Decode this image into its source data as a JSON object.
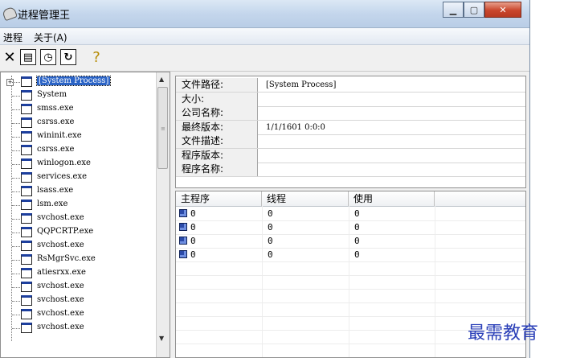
{
  "window": {
    "title": "进程管理王"
  },
  "menu": [
    "进程",
    "关于(A)"
  ],
  "toolbar": {
    "buttons": [
      {
        "name": "kill-process-button",
        "glyph": "✕",
        "icon": "close-icon"
      },
      {
        "name": "properties-button",
        "glyph": "▤",
        "icon": "properties-icon"
      },
      {
        "name": "timer-button",
        "glyph": "◷",
        "icon": "clock-icon"
      },
      {
        "name": "refresh-button",
        "glyph": "↻",
        "icon": "refresh-icon"
      },
      {
        "name": "help-button",
        "glyph": "?",
        "icon": "help-icon"
      }
    ]
  },
  "processes": [
    {
      "label": "[System Process]",
      "selected": true
    },
    {
      "label": "System"
    },
    {
      "label": "smss.exe"
    },
    {
      "label": "csrss.exe"
    },
    {
      "label": "wininit.exe"
    },
    {
      "label": "csrss.exe"
    },
    {
      "label": "winlogon.exe"
    },
    {
      "label": "services.exe"
    },
    {
      "label": "lsass.exe"
    },
    {
      "label": "lsm.exe"
    },
    {
      "label": "svchost.exe"
    },
    {
      "label": "QQPCRTP.exe"
    },
    {
      "label": "svchost.exe"
    },
    {
      "label": "RsMgrSvc.exe"
    },
    {
      "label": "atiesrxx.exe"
    },
    {
      "label": "svchost.exe"
    },
    {
      "label": "svchost.exe"
    },
    {
      "label": "svchost.exe"
    },
    {
      "label": "svchost.exe"
    }
  ],
  "info": [
    {
      "key": "文件路径:",
      "value": "[System Process]"
    },
    {
      "key": "大小:",
      "value": ""
    },
    {
      "key": "公司名称:",
      "value": ""
    },
    {
      "key": "最终版本:",
      "value": "1/1/1601 0:0:0"
    },
    {
      "key": "文件描述:",
      "value": ""
    },
    {
      "key": "程序版本:",
      "value": ""
    },
    {
      "key": "程序名称:",
      "value": ""
    }
  ],
  "modules": {
    "columns": [
      "主程序",
      "线程",
      "使用"
    ],
    "rows": [
      [
        "0",
        "0",
        "0"
      ],
      [
        "0",
        "0",
        "0"
      ],
      [
        "0",
        "0",
        "0"
      ],
      [
        "0",
        "0",
        "0"
      ]
    ]
  },
  "watermark": "最需教育"
}
